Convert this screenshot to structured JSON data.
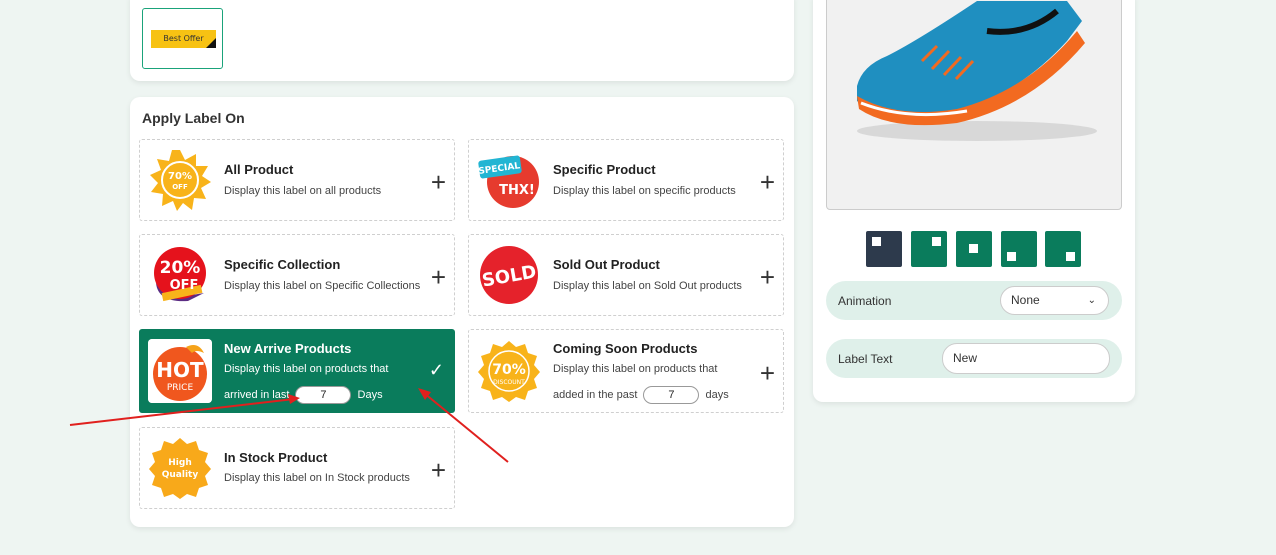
{
  "top_badge": {
    "text": "Best Offer"
  },
  "apply": {
    "title": "Apply Label On",
    "options": [
      {
        "name": "All Product",
        "desc": "Display this label on all products",
        "icon": "70% OFF",
        "icon_sub": "OFF"
      },
      {
        "name": "Specific Product",
        "desc": "Display this label on specific products",
        "icon": "SPECIAL",
        "icon_sub": "THX!"
      },
      {
        "name": "Specific Collection",
        "desc": "Display this label on Specific Collections",
        "icon": "20%",
        "icon_sub": "OFF"
      },
      {
        "name": "Sold Out Product",
        "desc": "Display this label on Sold Out products",
        "icon": "SOLD"
      },
      {
        "name": "New Arrive Products",
        "desc": "Display this label on products that",
        "pre": "arrived in last",
        "value": "7",
        "post": "Days",
        "icon": "HOT",
        "icon_sub": "PRICE"
      },
      {
        "name": "Coming Soon Products",
        "desc": "Display this label on products that",
        "pre": "added in the past",
        "value": "7",
        "post": "days",
        "icon": "70%",
        "icon_sub": "DISCOUNT"
      },
      {
        "name": "In Stock Product",
        "desc": "Display this label on In Stock products",
        "icon": "High",
        "icon_sub": "Quality"
      }
    ]
  },
  "settings": {
    "animation_label": "Animation",
    "animation_value": "None",
    "label_text_label": "Label Text",
    "label_text_value": "New"
  },
  "colors": {
    "accent": "#0a7c5c",
    "active_position": "#2d3a4c",
    "annotation": "#e0201e"
  }
}
